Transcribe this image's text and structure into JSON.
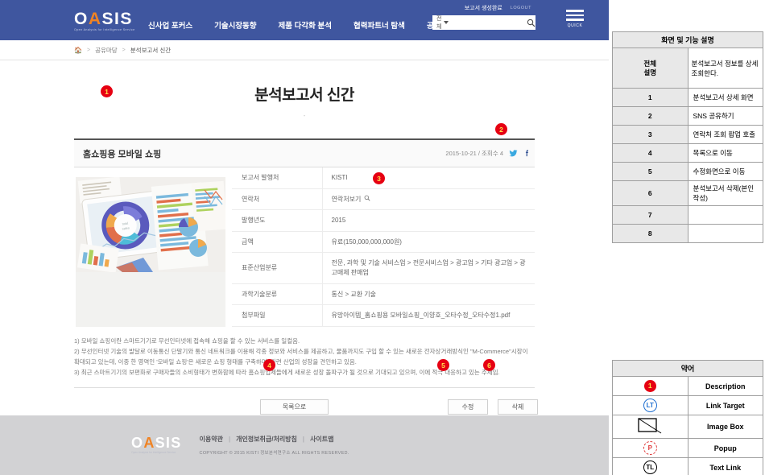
{
  "header": {
    "logo_text": "OASIS",
    "logo_o": "O",
    "logo_a": "A",
    "logo_sis": "SIS",
    "logo_tagline": "Open Analysis for Intelligence Service",
    "nav": [
      {
        "label": "신사업 포커스"
      },
      {
        "label": "기술시장동향"
      },
      {
        "label": "제품 다각화 분석"
      },
      {
        "label": "협력파트너 탐색"
      },
      {
        "label": "공유마당"
      }
    ],
    "user_status": "보고서 생성완료",
    "logout_label": "LOGOUT",
    "search_scope": "전체",
    "search_value": "",
    "search_placeholder": "",
    "search_icon": "search-icon",
    "quick_label": "QUICK",
    "brand_color": "#3f569f",
    "accent_color": "#f08323"
  },
  "breadcrumb": {
    "home_icon": "home-icon",
    "items": [
      "공유마당",
      "분석보고서 신간"
    ],
    "separator": ">"
  },
  "page": {
    "title": "분석보고서 신간",
    "subtitle": "-"
  },
  "report": {
    "title": "홈쇼핑용 모바일 쇼핑",
    "date_views": "2015-10-21 / 조회수 4",
    "sns": [
      {
        "name": "twitter-icon",
        "color": "#3aa9e0"
      },
      {
        "name": "facebook-icon",
        "color": "#3b5998"
      }
    ],
    "thumbnail_alt": "analysis-charts-photo",
    "fields": [
      {
        "label": "보고서 발행처",
        "value": "KISTI"
      },
      {
        "label": "연락처",
        "value": "연락처보기",
        "has_search_icon": true
      },
      {
        "label": "발행년도",
        "value": "2015"
      },
      {
        "label": "금액",
        "value": "유료(150,000,000,000원)"
      },
      {
        "label": "표준산업분류",
        "value": "전문, 과학 및 기술 서비스업 > 전문서비스업 > 광고업 > 기타 광고업 > 광고매체 판매업"
      },
      {
        "label": "과학기술분류",
        "value": "통신 > 교환 기술"
      },
      {
        "label": "첨부파일",
        "value": "유망아이템_홈쇼핑용 모바일쇼핑_이양호_오타수정_오타수정1.pdf"
      }
    ],
    "description": [
      "1) 모바일 쇼핑이란 스마트기기로 무선인터넷에 접속해 쇼핑을 할 수 있는 서비스를 일컬음.",
      "2) 무선인터넷 기술의 발달로 이동통신 단말기와 통신 네트워크를 이용해 각종 정보와 서비스를 제공하고, 물품까지도 구입 할 수 있는 새로운 전자상거래방식인 \"M-Commerce\"시장이 확대되고 있는데, 이중 한 영역인 '모바일 쇼핑'은 새로운 쇼핑 형태를 구축하며, 관련 산업의 성장을 견인하고 있음.",
      "3) 최근 스마트기기의 보편화로 구매자들의 소비형태가 변화함에 따라 홈쇼핑업체들에게 새로운 성장 돌파구가 될 것으로 기대되고 있으며, 이에 적극 대응하고 있는 추세임."
    ],
    "buttons": {
      "list": "목록으로",
      "edit": "수정",
      "delete": "삭제"
    }
  },
  "markers": [
    {
      "num": "1"
    },
    {
      "num": "2"
    },
    {
      "num": "3"
    },
    {
      "num": "4"
    },
    {
      "num": "5"
    },
    {
      "num": "6"
    }
  ],
  "footer": {
    "logo_o": "O",
    "logo_a": "A",
    "logo_sis": "SIS",
    "logo_tagline": "Open Analysis for Intelligence Service",
    "links": [
      "이용약관",
      "개인정보취급/처리방침",
      "사이트맵"
    ],
    "link_separator": "|",
    "copyright": "COPYRIGHT © 2015 KISTI 정보분석연구소 ALL RIGHTS RESERVED."
  },
  "side_panel": {
    "desc_table": {
      "header": "화면 및 기능 설명",
      "intro_label": "전체\n설명",
      "intro_text": "분석보고서 정보를 상세조회한다.",
      "rows": [
        {
          "idx": "1",
          "text": "분석보고서 상세 화면"
        },
        {
          "idx": "2",
          "text": "SNS 공유하기"
        },
        {
          "idx": "3",
          "text": "연락처 조회 팝업 호출"
        },
        {
          "idx": "4",
          "text": "목록으로 이동"
        },
        {
          "idx": "5",
          "text": "수정화면으로 이동"
        },
        {
          "idx": "6",
          "text": "분석보고서 삭제(본인작성)"
        },
        {
          "idx": "7",
          "text": ""
        },
        {
          "idx": "8",
          "text": ""
        }
      ]
    },
    "abbr_table": {
      "header": "약어",
      "rows": [
        {
          "symbol": "1",
          "symbol_kind": "num",
          "label": "Description"
        },
        {
          "symbol": "LT",
          "symbol_kind": "circle-blue",
          "label": "Link Target"
        },
        {
          "symbol": "",
          "symbol_kind": "imagebox",
          "label": "Image Box"
        },
        {
          "symbol": "P",
          "symbol_kind": "circle-dashed-red",
          "label": "Popup"
        },
        {
          "symbol": "TL",
          "symbol_kind": "circle-black",
          "label": "Text Link"
        }
      ]
    }
  }
}
